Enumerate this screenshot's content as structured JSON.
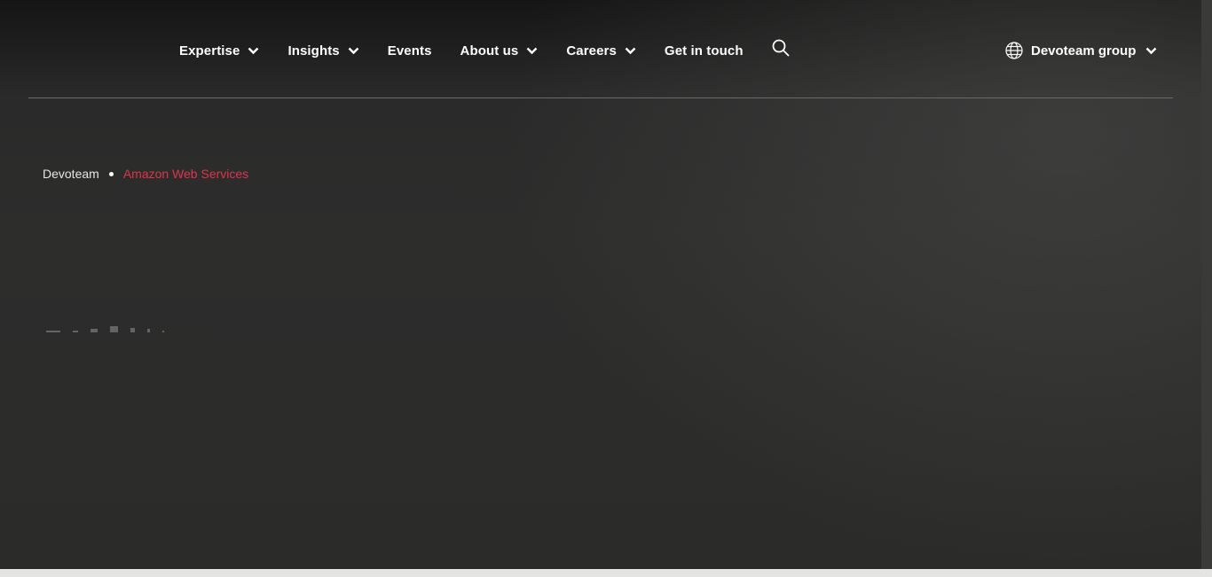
{
  "nav": {
    "items": [
      {
        "label": "Expertise",
        "dropdown": true
      },
      {
        "label": "Insights",
        "dropdown": true
      },
      {
        "label": "Events",
        "dropdown": false
      },
      {
        "label": "About us",
        "dropdown": true
      },
      {
        "label": "Careers",
        "dropdown": true
      },
      {
        "label": "Get in touch",
        "dropdown": false
      }
    ],
    "search_icon": "search-icon"
  },
  "group_selector": {
    "label": "Devoteam group",
    "icon": "globe-icon"
  },
  "breadcrumb": {
    "home": "Devoteam",
    "current": "Amazon Web Services"
  },
  "colors": {
    "accent": "#e0344d",
    "text": "#ffffff",
    "background": "#2b2b2a"
  }
}
